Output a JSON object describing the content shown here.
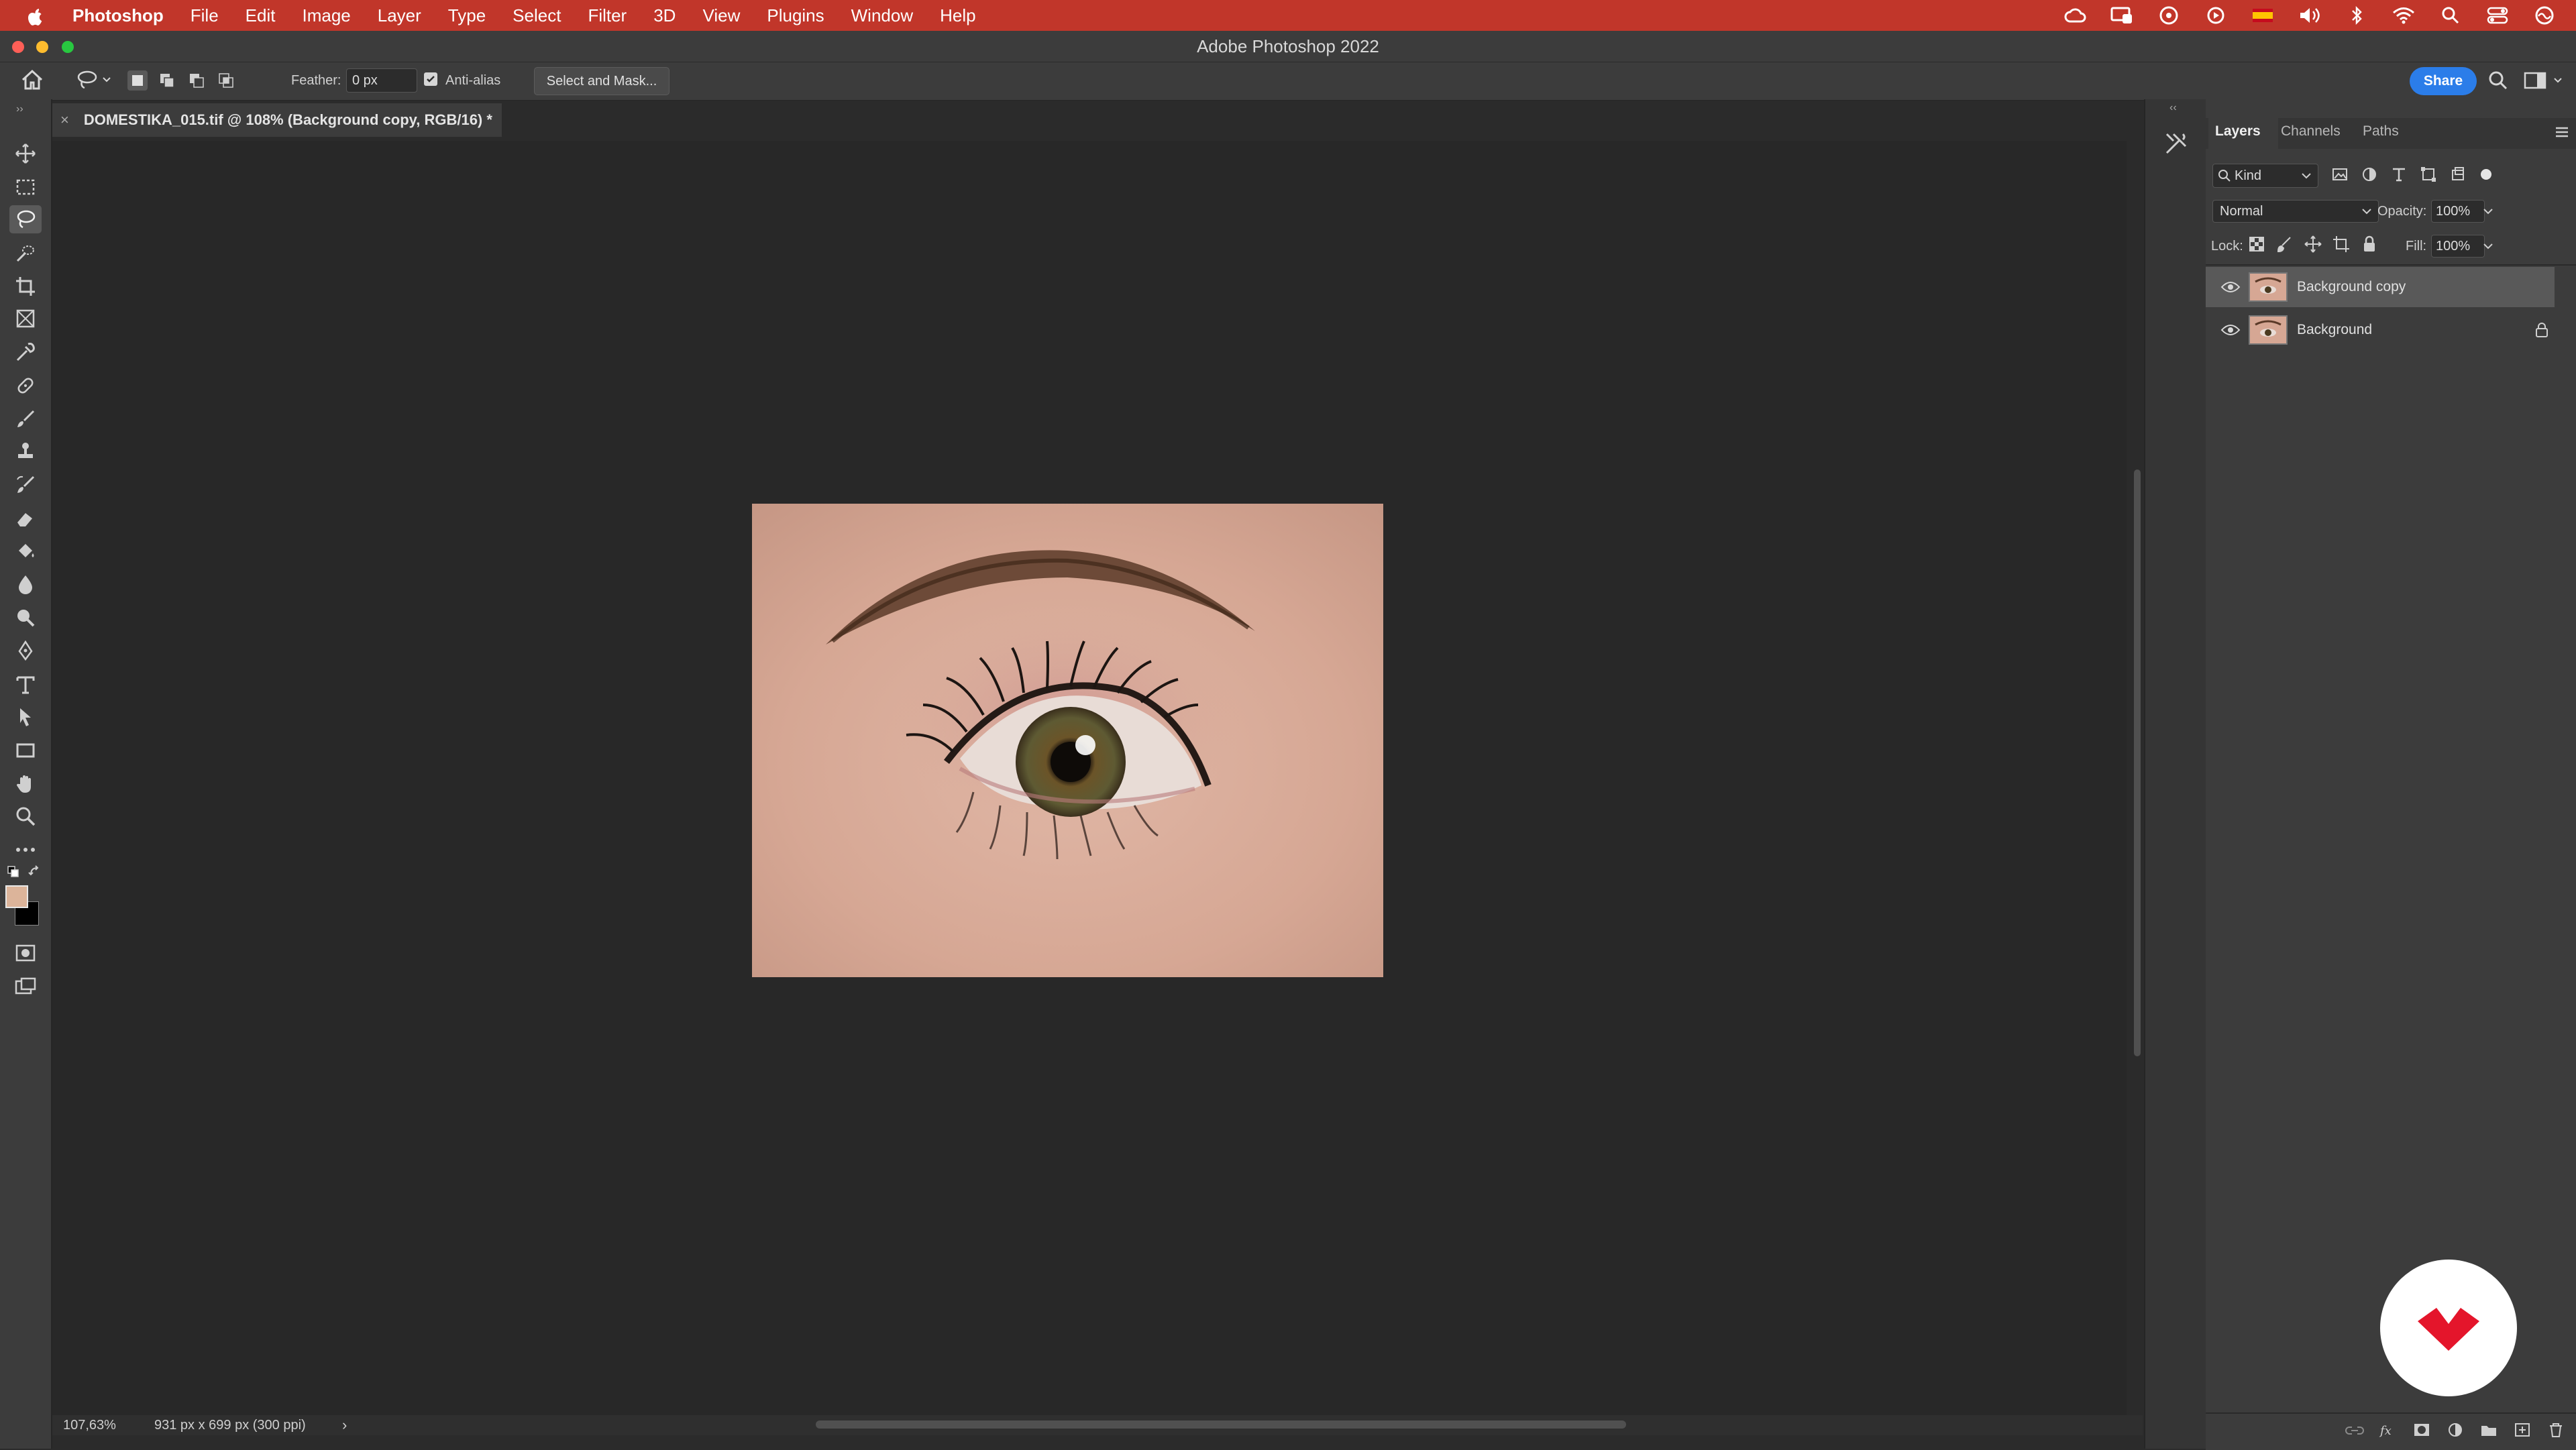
{
  "menubar": {
    "app_name": "Photoshop",
    "items": [
      "File",
      "Edit",
      "Image",
      "Layer",
      "Type",
      "Select",
      "Filter",
      "3D",
      "View",
      "Plugins",
      "Window",
      "Help"
    ],
    "status_icons": [
      "creative-cloud-icon",
      "screen-share-icon",
      "sync-icon",
      "play-icon",
      "flag-icon",
      "volume-icon",
      "bluetooth-icon",
      "wifi-icon",
      "spotlight-search-icon",
      "control-center-icon",
      "siri-icon"
    ]
  },
  "window": {
    "title": "Adobe Photoshop 2022"
  },
  "options": {
    "feather_label": "Feather:",
    "feather_value": "0 px",
    "antialias_label": "Anti-alias",
    "antialias_checked": true,
    "select_mask_label": "Select and Mask...",
    "share_label": "Share"
  },
  "document": {
    "tab_title": "DOMESTIKA_015.tif @ 108% (Background copy, RGB/16) *",
    "zoom": "107,63%",
    "dimensions": "931 px x 699 px (300 ppi)",
    "image_subject": "eye-photo"
  },
  "tools": [
    "move",
    "marquee",
    "lasso",
    "quick-select",
    "crop",
    "frame",
    "eyedropper",
    "healing",
    "brush",
    "stamp",
    "history-brush",
    "eraser",
    "gradient",
    "blur",
    "dodge",
    "pen",
    "type",
    "path-select",
    "rectangle",
    "hand",
    "zoom",
    "more"
  ],
  "colors": {
    "menubar": "#c1362a",
    "accent": "#2b7de9",
    "foreground_swatch": "#dcb49a",
    "background_swatch": "#000000"
  },
  "layers_panel": {
    "tabs": [
      "Layers",
      "Channels",
      "Paths"
    ],
    "active_tab": "Layers",
    "filter_kind": "Kind",
    "blend_mode": "Normal",
    "opacity_label": "Opacity:",
    "opacity_value": "100%",
    "lock_label": "Lock:",
    "fill_label": "Fill:",
    "fill_value": "100%",
    "layers": [
      {
        "name": "Background copy",
        "visible": true,
        "selected": true,
        "locked": false
      },
      {
        "name": "Background",
        "visible": true,
        "selected": false,
        "locked": true
      }
    ]
  }
}
